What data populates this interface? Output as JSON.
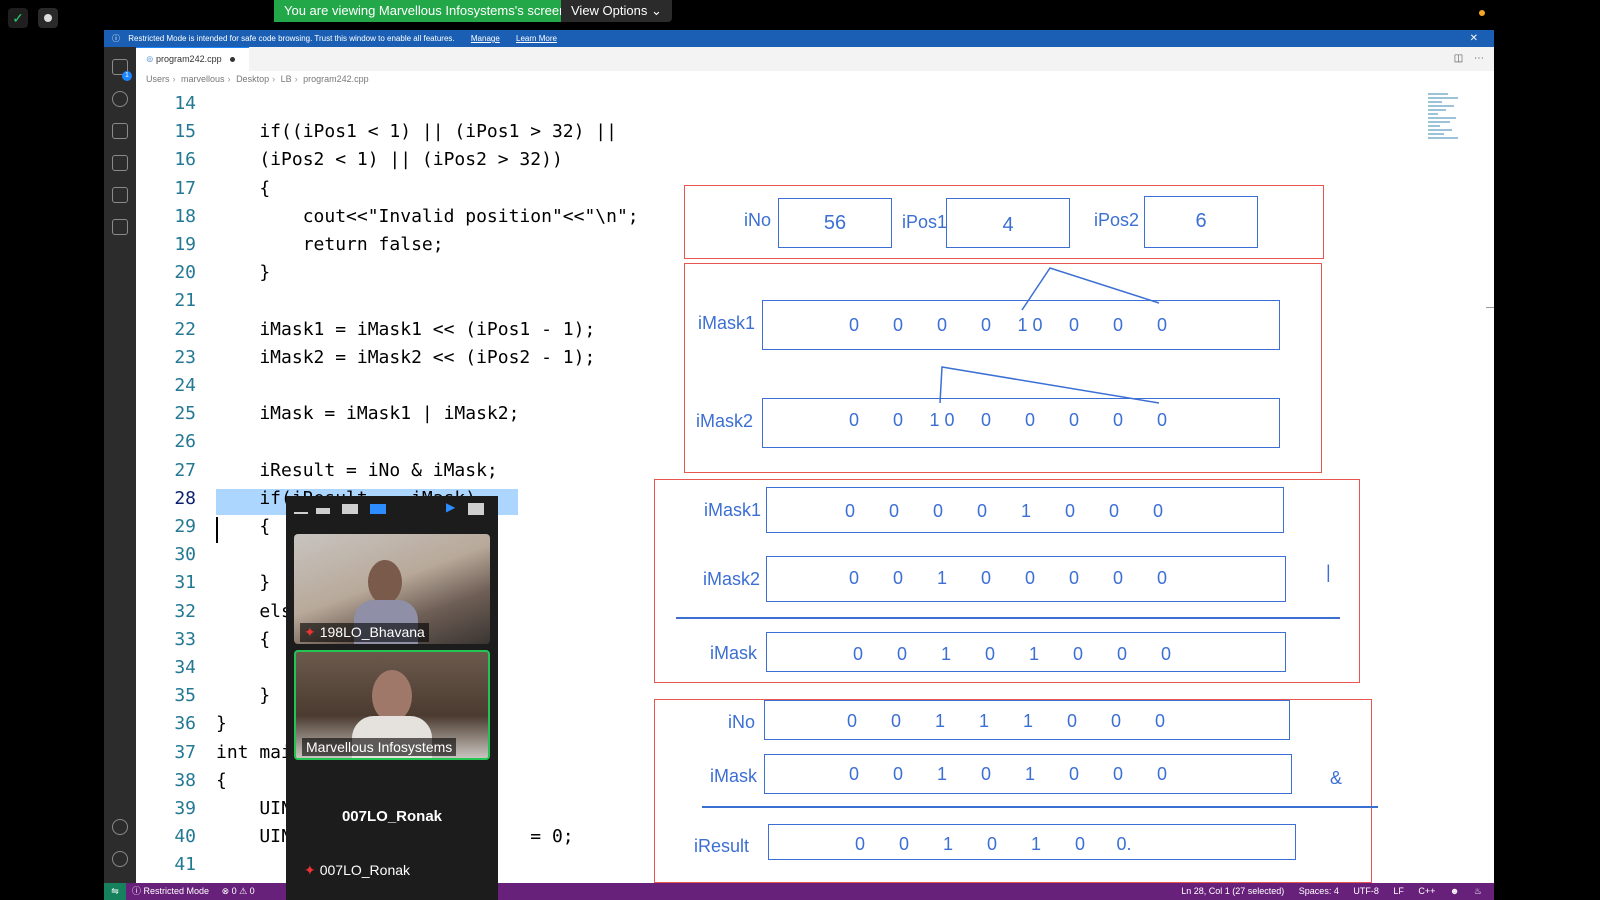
{
  "zoom": {
    "viewing_banner": "You are viewing Marvellous Infosystems's screen",
    "view_options_label": "View Options",
    "participants": [
      {
        "name": "198LO_Bhavana",
        "muted": true
      },
      {
        "name": "Marvellous Infosystems",
        "muted": false,
        "active_speaker": true
      },
      {
        "name": "007LO_Ronak",
        "muted": true,
        "display_name": "007LO_Ronak"
      }
    ]
  },
  "vscode": {
    "restricted_notice": "Restricted Mode is intended for safe code browsing. Trust this window to enable all features.",
    "manage_label": "Manage",
    "learn_more_label": "Learn More",
    "tab_filename": "program242.cpp",
    "breadcrumb": [
      "Users",
      "marvellous",
      "Desktop",
      "LB",
      "program242.cpp"
    ],
    "explorer_badge": "1",
    "code_lines": [
      {
        "num": "14",
        "text": ""
      },
      {
        "num": "15",
        "text": "    if((iPos1 < 1) || (iPos1 > 32) ||"
      },
      {
        "num": "16",
        "text": "    (iPos2 < 1) || (iPos2 > 32))"
      },
      {
        "num": "17",
        "text": "    {"
      },
      {
        "num": "18",
        "text": "        cout<<\"Invalid position\"<<\"\\n\";"
      },
      {
        "num": "19",
        "text": "        return false;"
      },
      {
        "num": "20",
        "text": "    }"
      },
      {
        "num": "21",
        "text": ""
      },
      {
        "num": "22",
        "text": "    iMask1 = iMask1 << (iPos1 - 1);"
      },
      {
        "num": "23",
        "text": "    iMask2 = iMask2 << (iPos2 - 1);"
      },
      {
        "num": "24",
        "text": ""
      },
      {
        "num": "25",
        "text": "    iMask = iMask1 | iMask2;"
      },
      {
        "num": "26",
        "text": ""
      },
      {
        "num": "27",
        "text": "    iResult = iNo & iMask;"
      },
      {
        "num": "28",
        "text": "    if(iResult == iMask)"
      },
      {
        "num": "29",
        "text": "    {"
      },
      {
        "num": "30",
        "text": ""
      },
      {
        "num": "31",
        "text": "    }"
      },
      {
        "num": "32",
        "text": "    else"
      },
      {
        "num": "33",
        "text": "    {"
      },
      {
        "num": "34",
        "text": ""
      },
      {
        "num": "35",
        "text": "    }"
      },
      {
        "num": "36",
        "text": "}"
      },
      {
        "num": "37",
        "text": "int main()"
      },
      {
        "num": "38",
        "text": "{"
      },
      {
        "num": "39",
        "text": "    UINT"
      },
      {
        "num": "40",
        "text": "    UINT                     = 0;"
      },
      {
        "num": "41",
        "text": ""
      }
    ],
    "status": {
      "restricted_mode": "Restricted Mode",
      "problems": "0 ⚠ 0",
      "position": "Ln 28, Col 1 (27 selected)",
      "spaces": "Spaces: 4",
      "encoding": "UTF-8",
      "eol": "LF",
      "language": "C++"
    }
  },
  "whiteboard": {
    "inputs": [
      {
        "label": "iNo",
        "value": "56"
      },
      {
        "label": "iPos1",
        "value": "4"
      },
      {
        "label": "iPos2",
        "value": "6"
      }
    ],
    "shift_section": [
      {
        "label": "iMask1",
        "bits": [
          "0",
          "0",
          "0",
          "0",
          "1 0",
          "0",
          "0",
          "0"
        ]
      },
      {
        "label": "iMask2",
        "bits": [
          "0",
          "0",
          "1 0",
          "0",
          "0",
          "0",
          "0",
          "0"
        ]
      }
    ],
    "or_section": {
      "operator": "|",
      "rows": [
        {
          "label": "iMask1",
          "bits": [
            "0",
            "0",
            "0",
            "0",
            "1",
            "0",
            "0",
            "0"
          ]
        },
        {
          "label": "iMask2",
          "bits": [
            "0",
            "0",
            "1",
            "0",
            "0",
            "0",
            "0",
            "0"
          ]
        },
        {
          "label": "iMask",
          "bits": [
            "0",
            "0",
            "1",
            "0",
            "1",
            "0",
            "0",
            "0"
          ]
        }
      ]
    },
    "and_section": {
      "operator": "&",
      "rows": [
        {
          "label": "iNo",
          "bits": [
            "0",
            "0",
            "1",
            "1",
            "1",
            "0",
            "0",
            "0"
          ]
        },
        {
          "label": "iMask",
          "bits": [
            "0",
            "0",
            "1",
            "0",
            "1",
            "0",
            "0",
            "0"
          ]
        },
        {
          "label": "iResult",
          "bits": [
            "0",
            "0",
            "1",
            "0",
            "1",
            "0",
            "0."
          ]
        }
      ]
    }
  }
}
